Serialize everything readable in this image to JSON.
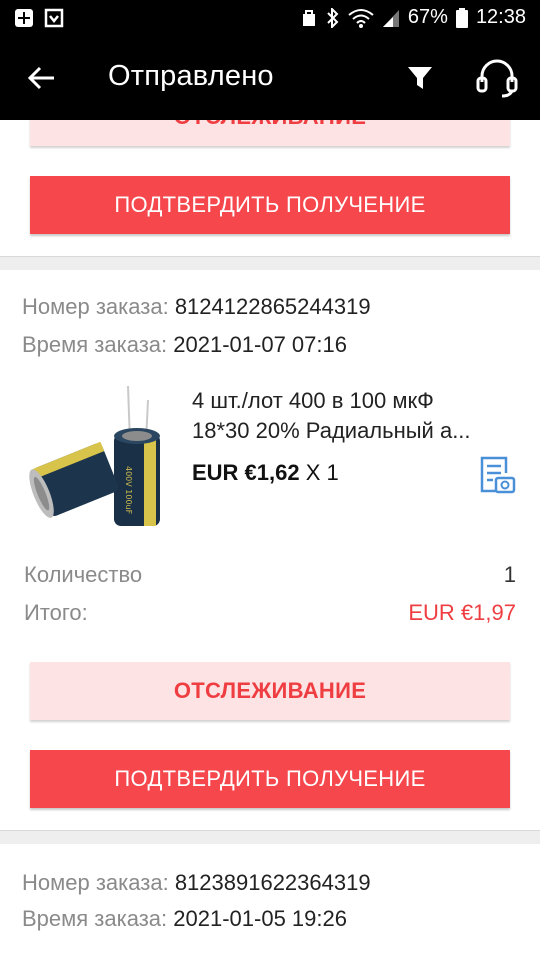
{
  "status_bar": {
    "battery": "67%",
    "time": "12:38"
  },
  "header": {
    "title": "Отправлено"
  },
  "buttons": {
    "track": "ОТСЛЕЖИВАНИЕ",
    "confirm": "ПОДТВЕРДИТЬ ПОЛУЧЕНИЕ"
  },
  "labels": {
    "order_number": "Номер заказа:",
    "order_time": "Время заказа:",
    "quantity": "Количество",
    "total": "Итого:"
  },
  "orders": [
    {
      "number": "8124122865244319",
      "time": "2021-01-07 07:16",
      "product": {
        "title_line1": "4 шт./лот 400 в 100 мкФ",
        "title_line2": "18*30 20% Радиальный а...",
        "price": "EUR €1,62",
        "qty_suffix": "X 1",
        "image_text": "400V 100uF"
      },
      "quantity": "1",
      "total": "EUR €1,97"
    },
    {
      "number": "8123891622364319",
      "time": "2021-01-05 19:26"
    }
  ],
  "colors": {
    "accent": "#f5474c",
    "accent_text": "#ef3e42",
    "track_bg": "#fde3e3",
    "snapshot_icon": "#4a90d9"
  }
}
